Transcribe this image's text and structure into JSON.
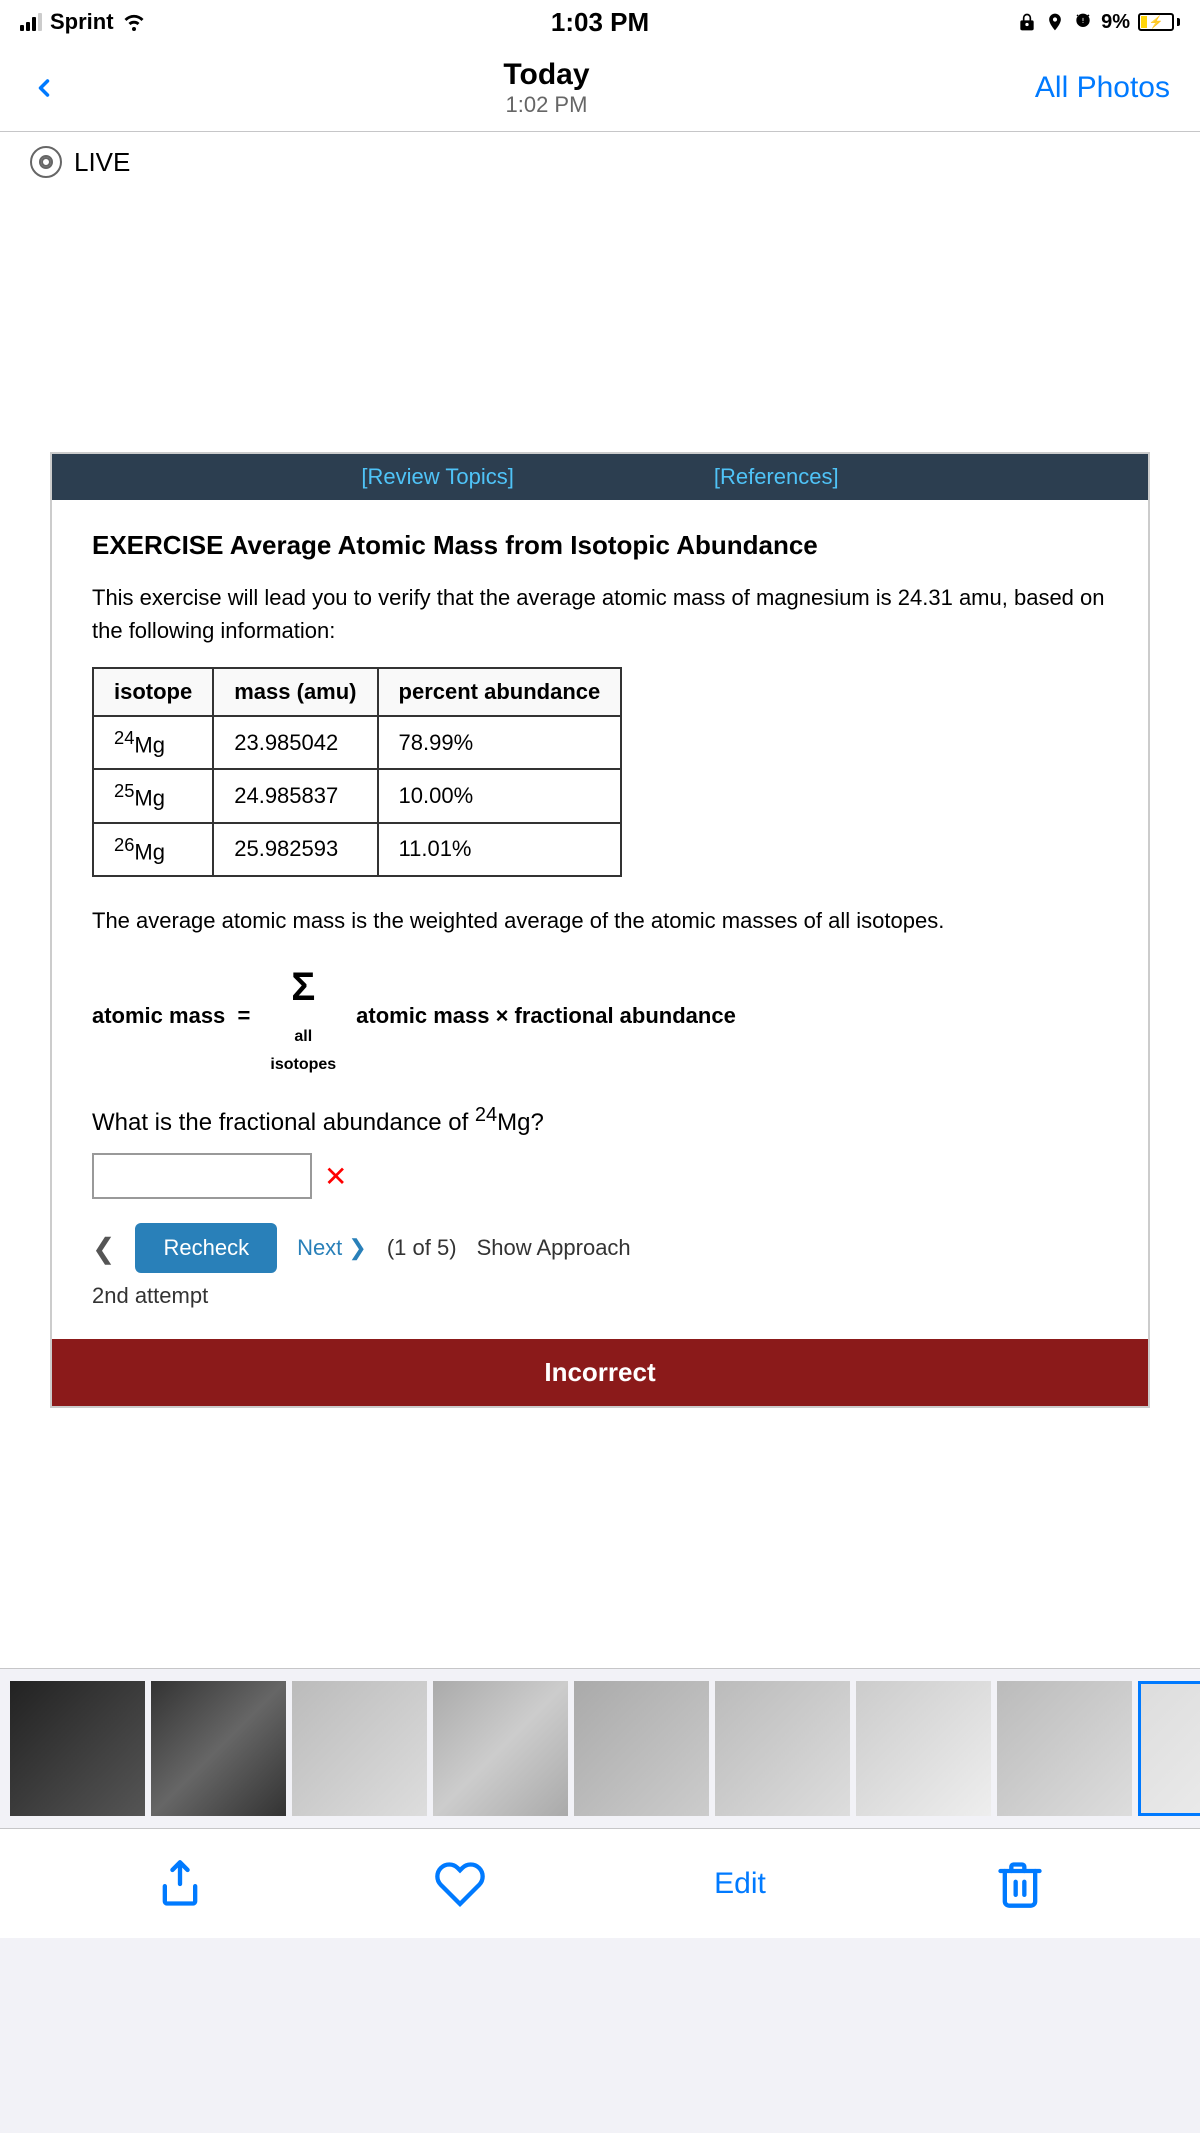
{
  "status_bar": {
    "carrier": "Sprint",
    "time": "1:03 PM",
    "battery_percent": "9%"
  },
  "nav": {
    "back_label": "",
    "title": "Today",
    "subtitle": "1:02 PM",
    "all_photos": "All Photos"
  },
  "live_label": "LIVE",
  "screenshot": {
    "review_topics": "[Review Topics]",
    "references": "[References]",
    "exercise_title": "EXERCISE  Average Atomic Mass from Isotopic Abundance",
    "description": "This exercise will lead you to verify that the average atomic mass of magnesium is 24.31 amu, based on the following information:",
    "table": {
      "headers": [
        "isotope",
        "mass (amu)",
        "percent abundance"
      ],
      "rows": [
        {
          "isotope": "²⁴Mg",
          "mass": "23.985042",
          "abundance": "78.99%"
        },
        {
          "isotope": "²⁵Mg",
          "mass": "24.985837",
          "abundance": "10.00%"
        },
        {
          "isotope": "²⁶Mg",
          "mass": "25.982593",
          "abundance": "11.01%"
        }
      ]
    },
    "formula_desc": "The average atomic mass is the weighted average of the atomic masses of all isotopes.",
    "formula_left": "atomic mass  =",
    "formula_sigma": "Σ",
    "formula_sub": "all",
    "formula_sub2": "isotopes",
    "formula_right": "atomic mass × fractional abundance",
    "question": "What is the fractional abundance of ²⁴Mg?",
    "recheck_label": "Recheck",
    "next_label": "Next",
    "step_label": "(1 of 5)",
    "show_approach": "Show Approach",
    "attempt_label": "2nd attempt",
    "incorrect_label": "Incorrect"
  },
  "toolbar": {
    "share_label": "",
    "like_label": "",
    "edit_label": "Edit",
    "delete_label": ""
  }
}
